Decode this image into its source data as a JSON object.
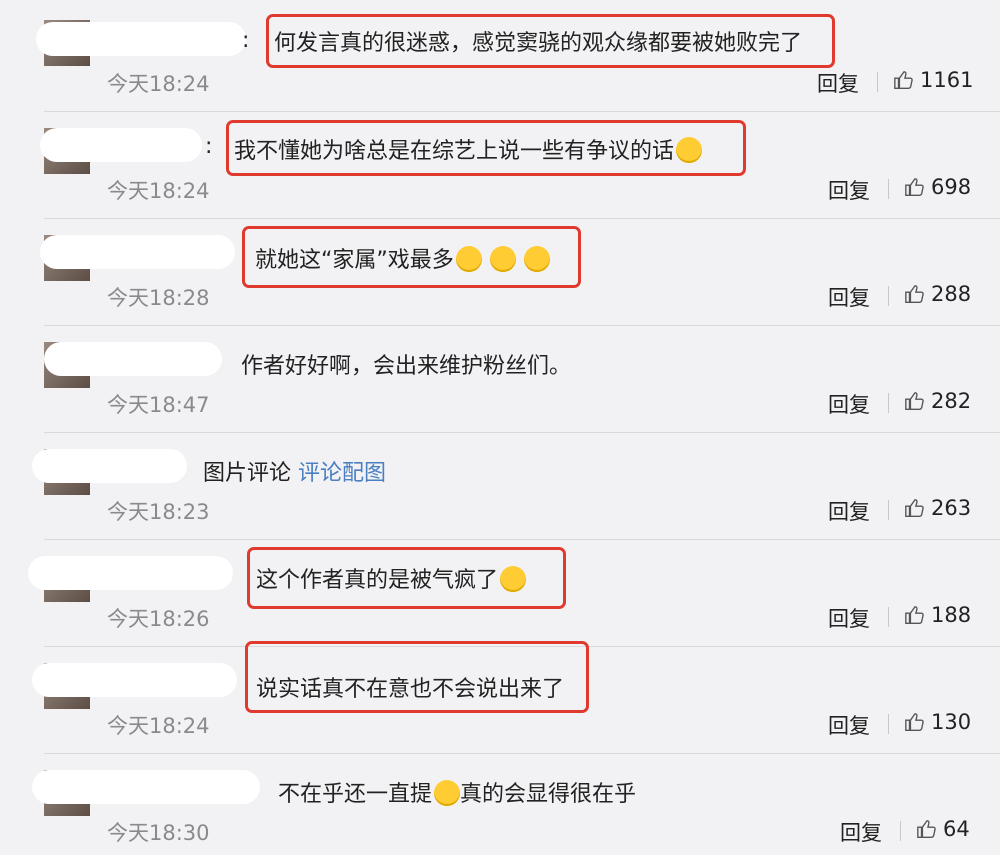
{
  "comments": [
    {
      "text": "何发言真的很迷惑，感觉窦骁的观众缘都要被她败完了",
      "time": "今天18:24",
      "reply": "回复",
      "likes": "1161",
      "emoji_count": 0
    },
    {
      "text": "我不懂她为啥总是在综艺上说一些有争议的话",
      "time": "今天18:24",
      "reply": "回复",
      "likes": "698",
      "emoji_count": 1
    },
    {
      "text": "就她这“家属”戏最多",
      "time": "今天18:28",
      "reply": "回复",
      "likes": "288",
      "emoji_count": 3
    },
    {
      "text": "作者好好啊，会出来维护粉丝们。",
      "time": "今天18:47",
      "reply": "回复",
      "likes": "282",
      "emoji_count": 0
    },
    {
      "text": "图片评论",
      "link": "评论配图",
      "time": "今天18:23",
      "reply": "回复",
      "likes": "263",
      "emoji_count": 0
    },
    {
      "text": "这个作者真的是被气疯了",
      "time": "今天18:26",
      "reply": "回复",
      "likes": "188",
      "emoji_count": 1
    },
    {
      "text": "说实话真不在意也不会说出来了",
      "time": "今天18:24",
      "reply": "回复",
      "likes": "130",
      "emoji_count": 0
    },
    {
      "text_before": "不在乎还一直提",
      "text_after": "真的会显得很在乎",
      "time": "今天18:30",
      "reply": "回复",
      "likes": "64",
      "emoji_count": 1
    }
  ],
  "colors": {
    "highlight": "#e03a2f",
    "link": "#4a7fc1",
    "time": "#8a8a8e"
  }
}
